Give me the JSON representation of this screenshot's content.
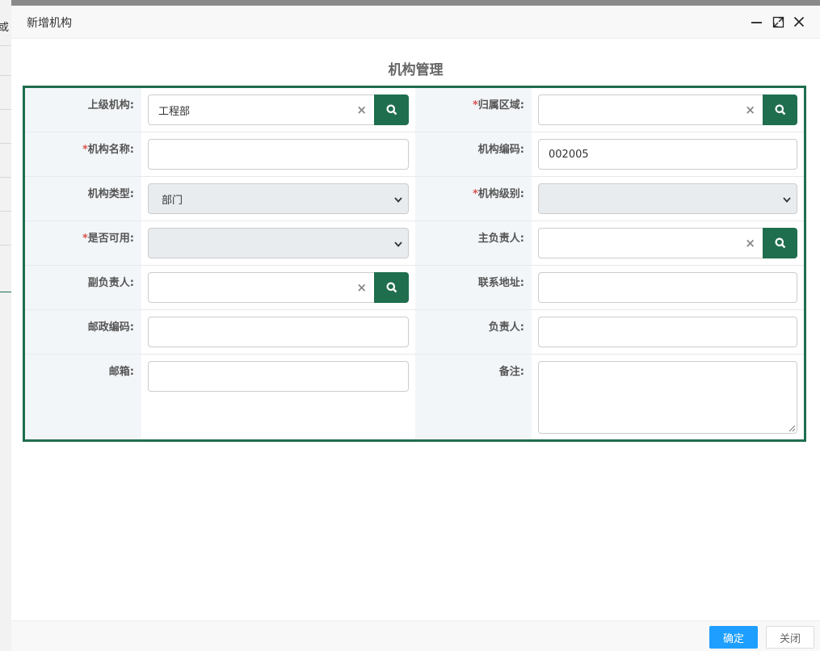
{
  "background": {
    "partial_char": "或"
  },
  "dialog": {
    "title": "新增机构",
    "form_title": "机构管理",
    "buttons": {
      "ok": "确定",
      "close": "关闭"
    }
  },
  "fields": {
    "parent_org": {
      "label": "上级机构:",
      "value": "工程部"
    },
    "region": {
      "required_mark": "*",
      "label": "归属区域:",
      "value": ""
    },
    "org_name": {
      "required_mark": "*",
      "label": "机构名称:",
      "value": ""
    },
    "org_code": {
      "label": "机构编码:",
      "value": "002005"
    },
    "org_type": {
      "label": "机构类型:",
      "value": "部门"
    },
    "org_level": {
      "required_mark": "*",
      "label": "机构级别:",
      "value": ""
    },
    "enabled": {
      "required_mark": "*",
      "label": "是否可用:",
      "value": ""
    },
    "primary_owner": {
      "label": "主负责人:",
      "value": ""
    },
    "deputy_owner": {
      "label": "副负责人:",
      "value": ""
    },
    "address": {
      "label": "联系地址:",
      "value": ""
    },
    "postal_code": {
      "label": "邮政编码:",
      "value": ""
    },
    "owner": {
      "label": "负责人:",
      "value": ""
    },
    "email": {
      "label": "邮箱:",
      "value": ""
    },
    "remark": {
      "label": "备注:",
      "value": ""
    }
  },
  "colors": {
    "accent": "#1f6e4e",
    "primary_button": "#1e9fff",
    "required": "#d9534f"
  },
  "icons": {
    "search": "search-icon",
    "clear": "clear-icon",
    "chevron": "chevron-down-icon"
  }
}
